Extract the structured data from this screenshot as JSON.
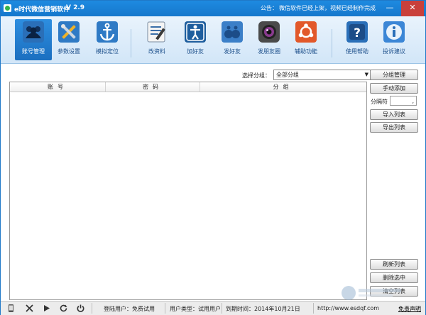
{
  "app": {
    "title": "e时代微信营销软件",
    "version": "V 2.9",
    "notice_label": "公告：",
    "notice_text": "微信软件已经上架，视频已经制作完成"
  },
  "toolbar": {
    "items": [
      {
        "label": "账号管理",
        "icon": "users-icon"
      },
      {
        "label": "参数设置",
        "icon": "tools-icon"
      },
      {
        "label": "模拟定位",
        "icon": "anchor-icon"
      },
      {
        "label": "改资料",
        "icon": "edit-profile-icon"
      },
      {
        "label": "加好友",
        "icon": "add-friend-icon"
      },
      {
        "label": "发好友",
        "icon": "send-friend-icon"
      },
      {
        "label": "发朋友圈",
        "icon": "camera-icon"
      },
      {
        "label": "辅助功能",
        "icon": "assist-icon"
      },
      {
        "label": "使用帮助",
        "icon": "help-icon"
      },
      {
        "label": "投诉建议",
        "icon": "info-icon"
      }
    ]
  },
  "filter": {
    "label": "选择分组：",
    "selected": "全部分组"
  },
  "table": {
    "columns": [
      "账号",
      "密码",
      "分组"
    ]
  },
  "side": {
    "group_manage": "分组管理",
    "manual_add": "手动添加",
    "separator_label": "分隔符",
    "separator_value": ",",
    "import_list": "导入列表",
    "export_list": "导出列表",
    "refresh_list": "刷新列表",
    "delete_selected": "删除选中",
    "clear_list": "清空列表"
  },
  "status": {
    "login_user": "登陆用户：免费试用",
    "user_type": "用户类型：试用用户",
    "expire": "到期时间：2014年10月21日",
    "website": "http://www.esdqf.com",
    "disclaimer": "免责声明"
  },
  "colors": {
    "title_bar": "#1e8ae0",
    "active_tab": "#2d8ee0",
    "close_button": "#c9403b"
  }
}
